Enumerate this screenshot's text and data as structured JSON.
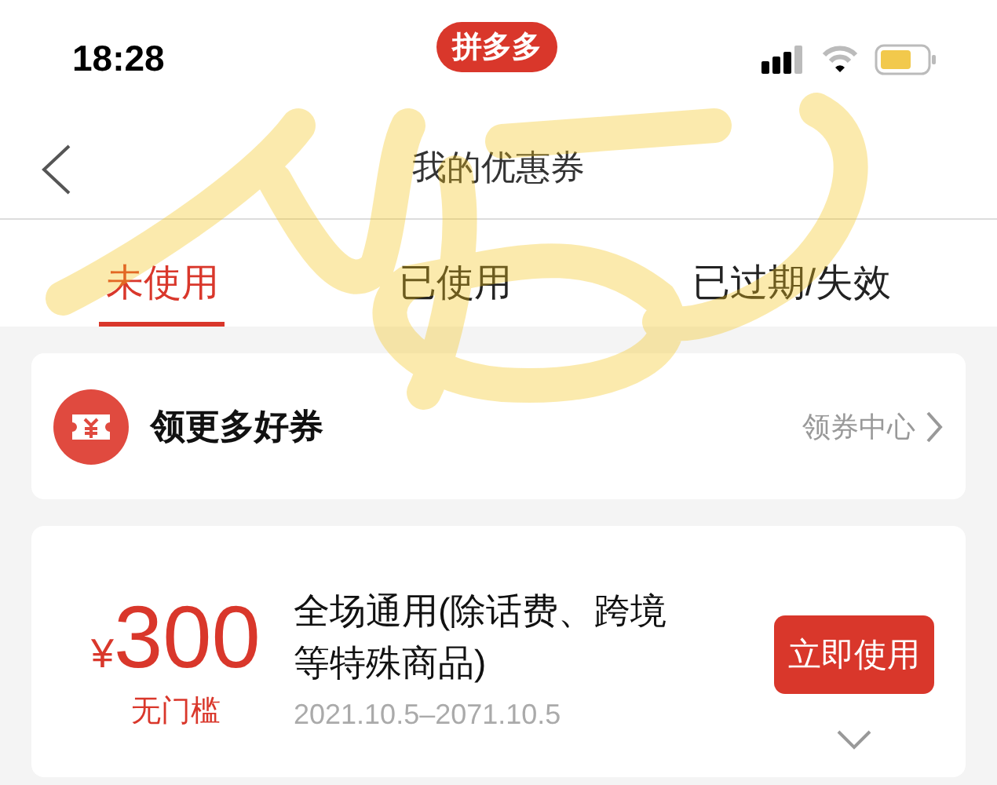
{
  "status_bar": {
    "time": "18:28",
    "app_badge": "拼多多"
  },
  "nav": {
    "title": "我的优惠券"
  },
  "tabs": [
    {
      "label": "未使用",
      "selected": true
    },
    {
      "label": "已使用",
      "selected": false
    },
    {
      "label": "已过期/失效",
      "selected": false
    }
  ],
  "promo": {
    "title": "领更多好券",
    "link": "领券中心"
  },
  "coupons": [
    {
      "currency": "¥",
      "amount": "300",
      "threshold": "无门槛",
      "description": "全场通用(除话费、跨境等特殊商品)",
      "validity": "2021.10.5–2071.10.5",
      "button": "立即使用"
    }
  ]
}
